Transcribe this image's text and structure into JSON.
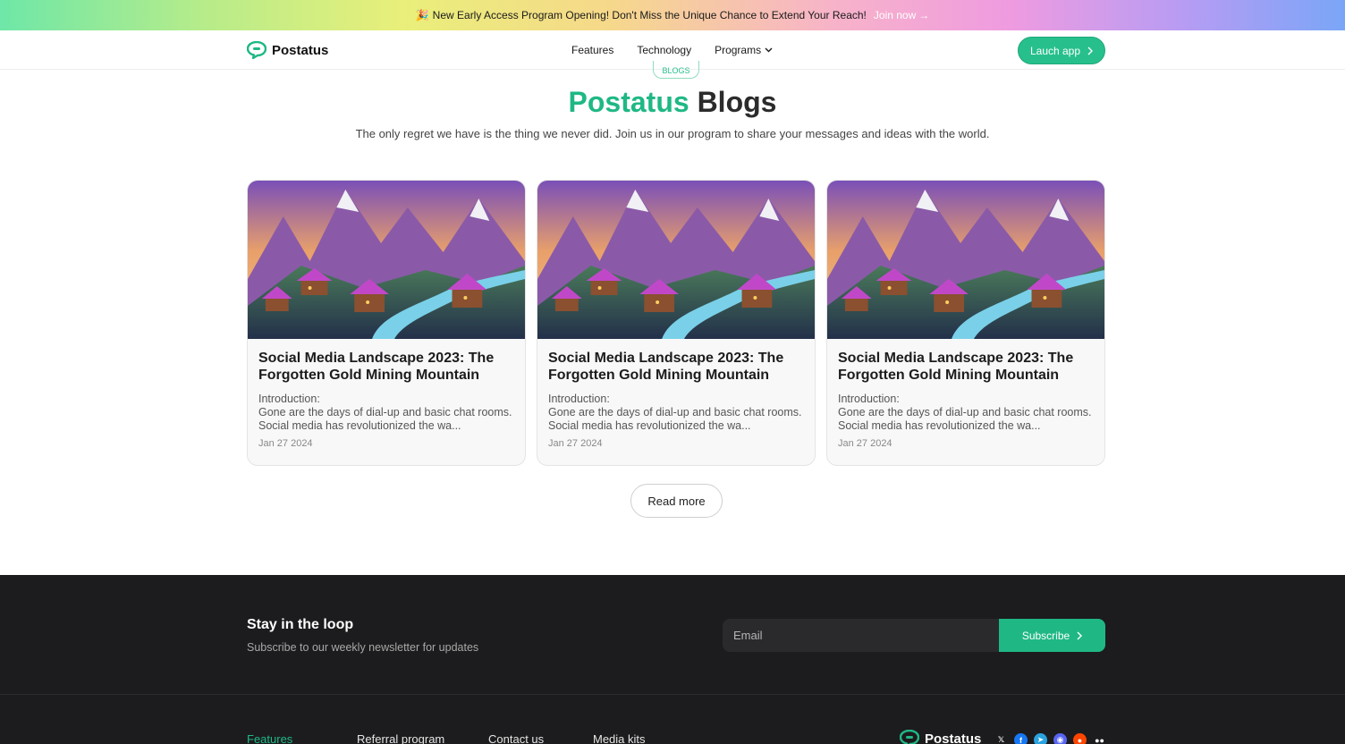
{
  "banner": {
    "emoji": "🎉",
    "text": "New Early Access Program Opening! Don't Miss the Unique Chance to Extend Your Reach!",
    "link_label": "Join now",
    "link_arrow": "→"
  },
  "nav": {
    "brand": "Postatus",
    "items": [
      {
        "label": "Features"
      },
      {
        "label": "Technology"
      },
      {
        "label": "Programs"
      }
    ],
    "launch_label": "Lauch app"
  },
  "hero": {
    "badge": "BLOGS",
    "title_accent": "Postatus",
    "title_rest": "Blogs",
    "subtitle": "The only regret we have is the thing we never did. Join us in our program to share your messages and ideas with the world."
  },
  "posts": [
    {
      "title": "Social Media Landscape 2023: The Forgotten Gold Mining Mountain",
      "intro": "Introduction:",
      "excerpt": "Gone are the days of dial-up and basic chat rooms. Social media has revolutionized the wa...",
      "date": "Jan 27 2024"
    },
    {
      "title": "Social Media Landscape 2023: The Forgotten Gold Mining Mountain",
      "intro": "Introduction:",
      "excerpt": "Gone are the days of dial-up and basic chat rooms. Social media has revolutionized the wa...",
      "date": "Jan 27 2024"
    },
    {
      "title": "Social Media Landscape 2023: The Forgotten Gold Mining Mountain",
      "intro": "Introduction:",
      "excerpt": "Gone are the days of dial-up and basic chat rooms. Social media has revolutionized the wa...",
      "date": "Jan 27 2024"
    }
  ],
  "read_more_label": "Read more",
  "newsletter": {
    "title": "Stay in the loop",
    "subtitle": "Subscribe to our weekly newsletter for updates",
    "email_placeholder": "Email",
    "subscribe_label": "Subscribe"
  },
  "footer": {
    "links": [
      {
        "label": "Features"
      },
      {
        "label": "Referral program"
      },
      {
        "label": "Contact us"
      },
      {
        "label": "Media kits"
      }
    ],
    "brand": "Postatus",
    "socials": [
      {
        "name": "x-icon",
        "glyph": "𝕏",
        "color": "#1c1c1e"
      },
      {
        "name": "facebook-icon",
        "glyph": "f",
        "color": "#1877f2"
      },
      {
        "name": "telegram-icon",
        "glyph": "➤",
        "color": "#2aa3e0"
      },
      {
        "name": "discord-icon",
        "glyph": "◉",
        "color": "#5865f2"
      },
      {
        "name": "reddit-icon",
        "glyph": "●",
        "color": "#ff4500"
      },
      {
        "name": "medium-icon",
        "glyph": "●●",
        "color": "#1c1c1e"
      }
    ]
  },
  "colors": {
    "accent": "#1fb884",
    "footer_bg": "#1c1c1e"
  }
}
